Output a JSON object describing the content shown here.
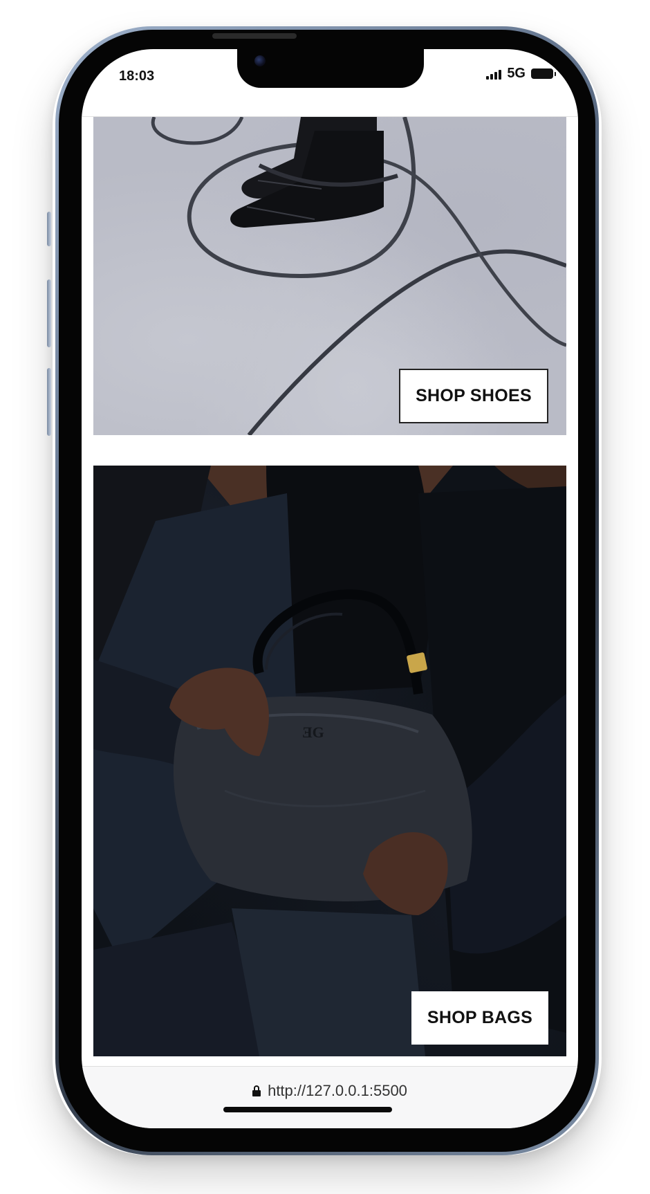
{
  "status_bar": {
    "time": "18:03",
    "network": "5G"
  },
  "promos": {
    "shoes": {
      "button_label": "SHOP SHOES"
    },
    "bags": {
      "button_label": "SHOP BAGS"
    }
  },
  "browser": {
    "url": "http://127.0.0.1:5500"
  },
  "icons": {
    "signal": "cellular-signal-icon",
    "battery": "battery-icon",
    "lock": "lock-icon"
  },
  "colors": {
    "button_bg": "#ffffff",
    "button_text": "#111111",
    "shoes_backdrop": "#b9bbc6",
    "bags_backdrop": "#0e1218"
  }
}
